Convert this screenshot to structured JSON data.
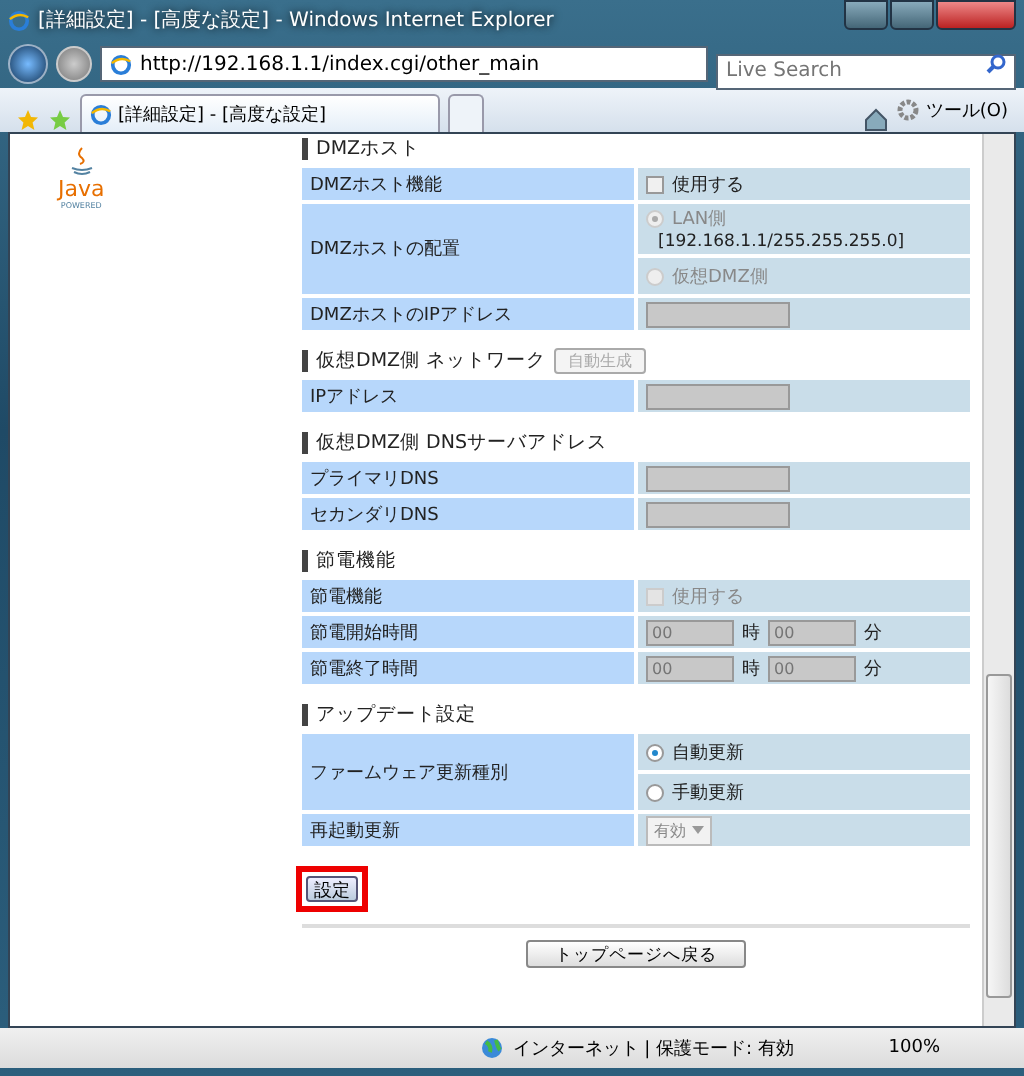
{
  "window": {
    "title": "[詳細設定] - [高度な設定] - Windows Internet Explorer"
  },
  "address_bar": {
    "url": "http://192.168.1.1/index.cgi/other_main"
  },
  "search": {
    "placeholder": "Live Search"
  },
  "tab": {
    "label": "[詳細設定] - [高度な設定]"
  },
  "tools_menu": "ツール(O)",
  "logo": {
    "name": "Java",
    "caption": "POWERED"
  },
  "sections": [
    {
      "title": "DMZホスト",
      "rows": [
        {
          "label": "DMZホスト機能",
          "kind": "checkbox",
          "option": "使用する",
          "checked": false,
          "disabled": false
        },
        {
          "label": "DMZホストの配置",
          "kind": "radios",
          "disabled": true,
          "options": [
            {
              "label": "LAN側",
              "sublabel": "[192.168.1.1/255.255.255.0]",
              "selected": true
            },
            {
              "label": "仮想DMZ側",
              "selected": false
            }
          ]
        },
        {
          "label": "DMZホストのIPアドレス",
          "kind": "input",
          "disabled": true
        }
      ]
    },
    {
      "title": "仮想DMZ側 ネットワーク",
      "button": {
        "label": "自動生成",
        "disabled": true
      },
      "rows": [
        {
          "label": "IPアドレス",
          "kind": "input",
          "disabled": true
        }
      ]
    },
    {
      "title": "仮想DMZ側 DNSサーバアドレス",
      "rows": [
        {
          "label": "プライマリDNS",
          "kind": "input",
          "disabled": true
        },
        {
          "label": "セカンダリDNS",
          "kind": "input",
          "disabled": true
        }
      ]
    },
    {
      "title": "節電機能",
      "rows": [
        {
          "label": "節電機能",
          "kind": "checkbox",
          "option": "使用する",
          "checked": false,
          "disabled": true
        },
        {
          "label": "節電開始時間",
          "kind": "time",
          "disabled": true,
          "hour_placeholder": "00",
          "hour_unit": "時",
          "minute_placeholder": "00",
          "minute_unit": "分"
        },
        {
          "label": "節電終了時間",
          "kind": "time",
          "disabled": true,
          "hour_placeholder": "00",
          "hour_unit": "時",
          "minute_placeholder": "00",
          "minute_unit": "分"
        }
      ]
    },
    {
      "title": "アップデート設定",
      "rows": [
        {
          "label": "ファームウェア更新種別",
          "kind": "radios",
          "disabled": false,
          "options": [
            {
              "label": "自動更新",
              "selected": true
            },
            {
              "label": "手動更新",
              "selected": false
            }
          ]
        },
        {
          "label": "再起動更新",
          "kind": "select",
          "value": "有効",
          "disabled": true
        }
      ]
    }
  ],
  "submit_button": {
    "label": "設定",
    "highlighted": true
  },
  "back_button": "トップページへ戻る",
  "status_bar": {
    "zone": "インターネット | 保護モード: 有効",
    "zoom": "100%"
  }
}
